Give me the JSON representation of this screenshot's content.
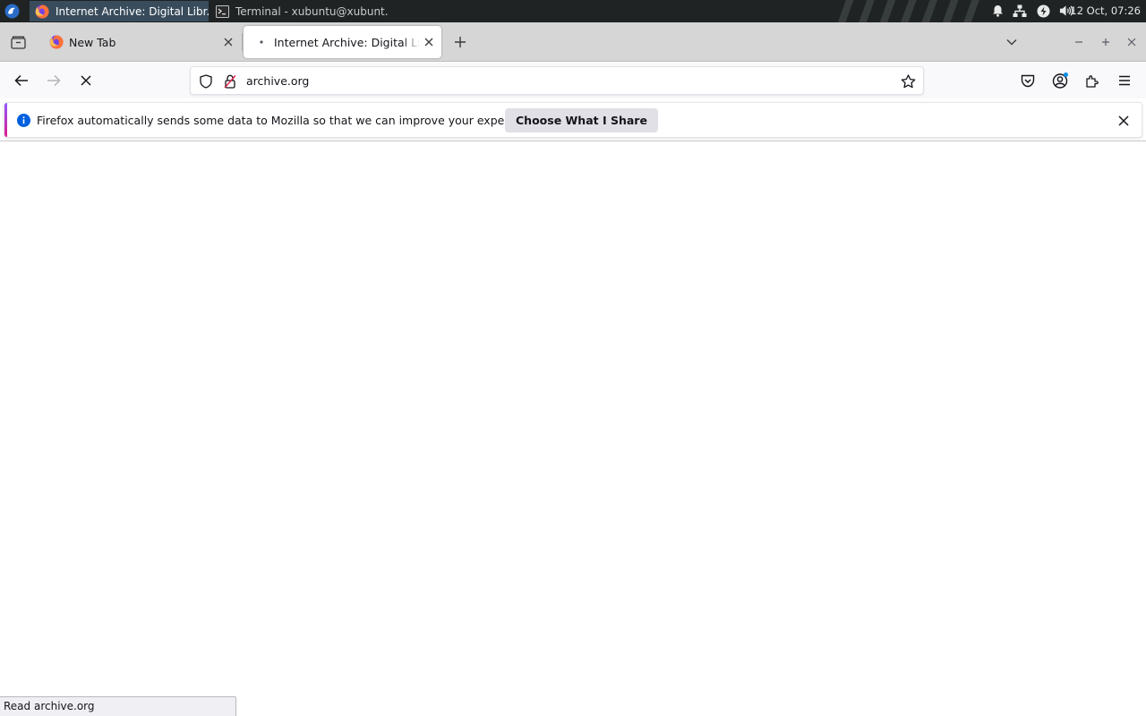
{
  "panel": {
    "tasks": [
      {
        "title": "Internet Archive: Digital Libr...",
        "icon": "firefox-icon",
        "active": true
      },
      {
        "title": "Terminal - xubuntu@xubunt...",
        "icon": "terminal-icon",
        "active": false
      }
    ],
    "tray_icons": [
      "bell-icon",
      "network-icon",
      "power-icon",
      "volume-icon"
    ],
    "clock": "12 Oct, 07:26"
  },
  "browser": {
    "tabs": [
      {
        "label": "New Tab",
        "icon": "firefox-icon",
        "selected": false
      },
      {
        "label": "Internet Archive: Digital Library",
        "icon": "loading-dot-icon",
        "selected": true
      }
    ],
    "url": "archive.org",
    "notification": {
      "message": "Firefox automatically sends some data to Mozilla so that we can improve your experience.",
      "button_label": "Choose What I Share"
    },
    "status_text": "Read archive.org"
  },
  "colors": {
    "panel_bg": "#1f2323",
    "active_task_bg": "#394c5c",
    "tabbar_bg": "#d6d6d6",
    "info_blue": "#0060df",
    "notification_accent": "#9059ff"
  }
}
